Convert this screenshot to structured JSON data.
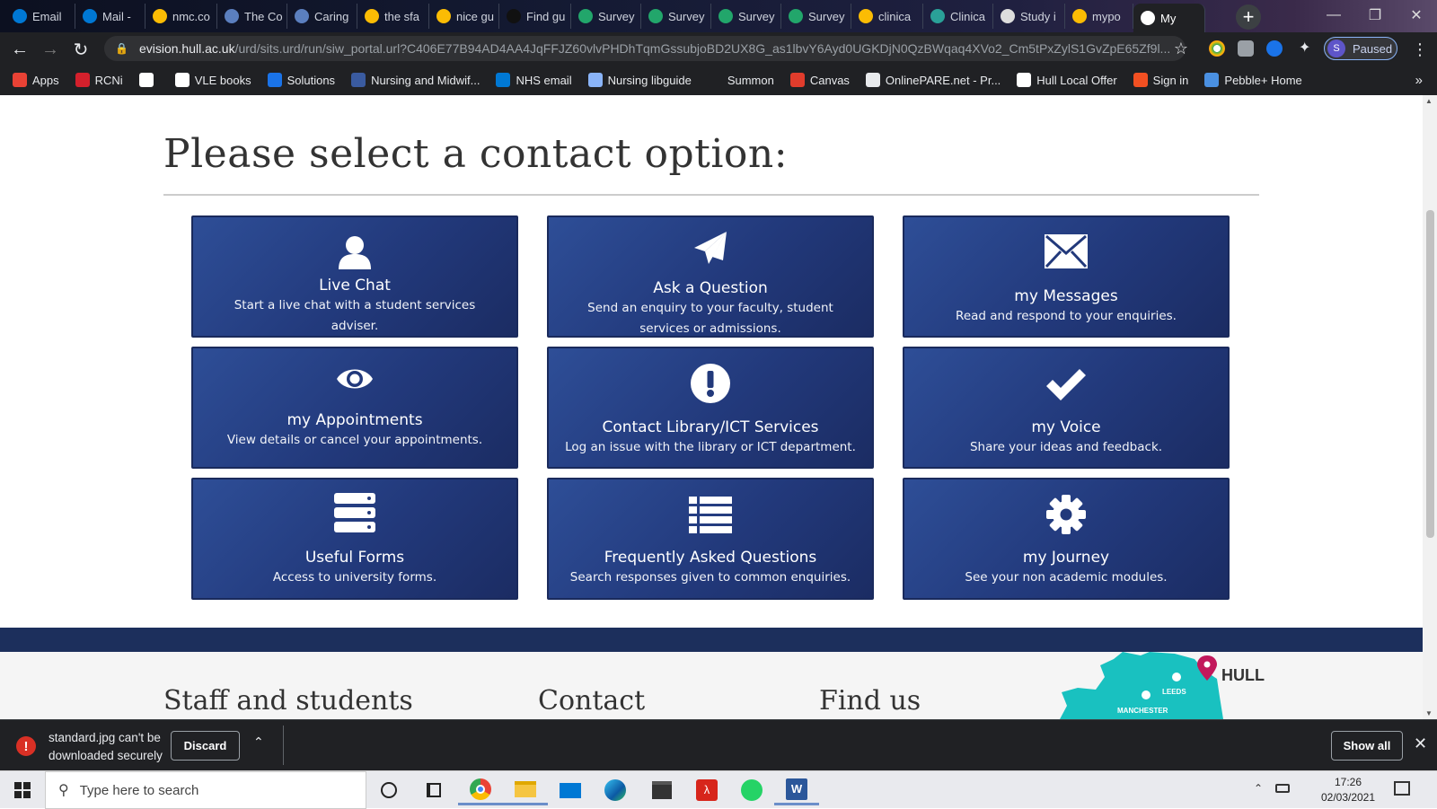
{
  "browser": {
    "tabs": [
      {
        "label": "Email",
        "icon": "outlook-icon",
        "color": "#0078d4"
      },
      {
        "label": "Mail -",
        "icon": "outlook-icon",
        "color": "#0078d4"
      },
      {
        "label": "nmc.co",
        "icon": "chrome-icon",
        "color": "#fbbc04"
      },
      {
        "label": "The Co",
        "icon": "caduceus-icon",
        "color": "#5b7fbf"
      },
      {
        "label": "Caring",
        "icon": "caduceus-icon",
        "color": "#5b7fbf"
      },
      {
        "label": "the sfa",
        "icon": "chrome-icon",
        "color": "#fbbc04"
      },
      {
        "label": "nice gu",
        "icon": "chrome-icon",
        "color": "#fbbc04"
      },
      {
        "label": "Find gu",
        "icon": "nice-icon",
        "color": "#111111"
      },
      {
        "label": "Survey",
        "icon": "survey-icon",
        "color": "#22a66b"
      },
      {
        "label": "Survey",
        "icon": "survey-icon",
        "color": "#22a66b"
      },
      {
        "label": "Survey",
        "icon": "survey-icon",
        "color": "#22a66b"
      },
      {
        "label": "Survey",
        "icon": "survey-icon",
        "color": "#22a66b"
      },
      {
        "label": "clinica",
        "icon": "chrome-icon",
        "color": "#fbbc04"
      },
      {
        "label": "Clinica",
        "icon": "globe-icon",
        "color": "#2aa198"
      },
      {
        "label": "Study i",
        "icon": "caduceus-icon",
        "color": "#dddddd"
      },
      {
        "label": "mypo",
        "icon": "chrome-icon",
        "color": "#fbbc04"
      },
      {
        "label": "My",
        "icon": "hull-icon",
        "color": "#ffffff"
      }
    ],
    "new_tab_glyph": "+",
    "url_host": "evision.hull.ac.uk",
    "url_path": "/urd/sits.urd/run/siw_portal.url?C406E77B94AD4AA4JqFFJZ60vlvPHDhTqmGssubjoBD2UX8G_as1lbvY6Ayd0UGKDjN0QzBWqaq4XVo2_Cm5tPxZylS1GvZpE65Zf9l...",
    "profile_initial": "S",
    "profile_status": "Paused",
    "bookmarks": [
      {
        "label": "Apps",
        "color": "#e94235"
      },
      {
        "label": "RCNi",
        "color": "#d4202c"
      },
      {
        "label": "",
        "color": "#ffffff"
      },
      {
        "label": "VLE books",
        "color": "#ffffff"
      },
      {
        "label": "Solutions",
        "color": "#1a73e8"
      },
      {
        "label": "Nursing and Midwif...",
        "color": "#3a5ba0"
      },
      {
        "label": "NHS email",
        "color": "#0078d4"
      },
      {
        "label": "Nursing libguide",
        "color": "#8ab4f8"
      },
      {
        "label": "Summon",
        "color": "#202124"
      },
      {
        "label": "Canvas",
        "color": "#e13c2c"
      },
      {
        "label": "OnlinePARE.net - Pr...",
        "color": "#e8eaed"
      },
      {
        "label": "Hull Local Offer",
        "color": "#ffffff"
      },
      {
        "label": "Sign in",
        "color": "#f25022"
      },
      {
        "label": "Pebble+ Home",
        "color": "#4a90e2"
      }
    ],
    "bookmarks_overflow": "»"
  },
  "page": {
    "title": "Please select a contact option:",
    "cards": [
      {
        "title": "Live Chat",
        "desc": "Start a live chat with a student services adviser.",
        "icon": "user-icon"
      },
      {
        "title": "Ask a Question",
        "desc": "Send an enquiry to your faculty, student services or admissions.",
        "icon": "paper-plane-icon"
      },
      {
        "title": "my Messages",
        "desc": "Read and respond to your enquiries.",
        "icon": "envelope-icon"
      },
      {
        "title": "my Appointments",
        "desc": "View details or cancel your appointments.",
        "icon": "eye-icon"
      },
      {
        "title": "Contact Library/ICT Services",
        "desc": "Log an issue with the library or ICT department.",
        "icon": "exclamation-icon"
      },
      {
        "title": "my Voice",
        "desc": "Share your ideas and feedback.",
        "icon": "checkmark-icon"
      },
      {
        "title": "Useful Forms",
        "desc": "Access to university forms.",
        "icon": "server-icon"
      },
      {
        "title": "Frequently Asked Questions",
        "desc": "Search responses given to common enquiries.",
        "icon": "list-icon"
      },
      {
        "title": "my Journey",
        "desc": "See your non academic modules.",
        "icon": "gear-icon"
      }
    ],
    "card_color": "#22397b",
    "footer": {
      "col1": "Staff and students",
      "col2": "Contact",
      "col3": "Find us",
      "map_labels": {
        "city1": "LEEDS",
        "city2": "MANCHESTER",
        "city3": "HULL"
      },
      "map_color": "#19c1c0",
      "pin_color": "#c2185b"
    }
  },
  "download": {
    "message": "standard.jpg can't be downloaded securely",
    "discard": "Discard",
    "show_all": "Show all"
  },
  "taskbar": {
    "search_placeholder": "Type here to search",
    "time": "17:26",
    "date": "02/03/2021",
    "apps": [
      "cortana-icon",
      "task-view-icon",
      "chrome-icon",
      "file-explorer-icon",
      "mail-icon",
      "edge-icon",
      "store-icon",
      "acrobat-icon",
      "whatsapp-icon",
      "word-icon"
    ]
  }
}
